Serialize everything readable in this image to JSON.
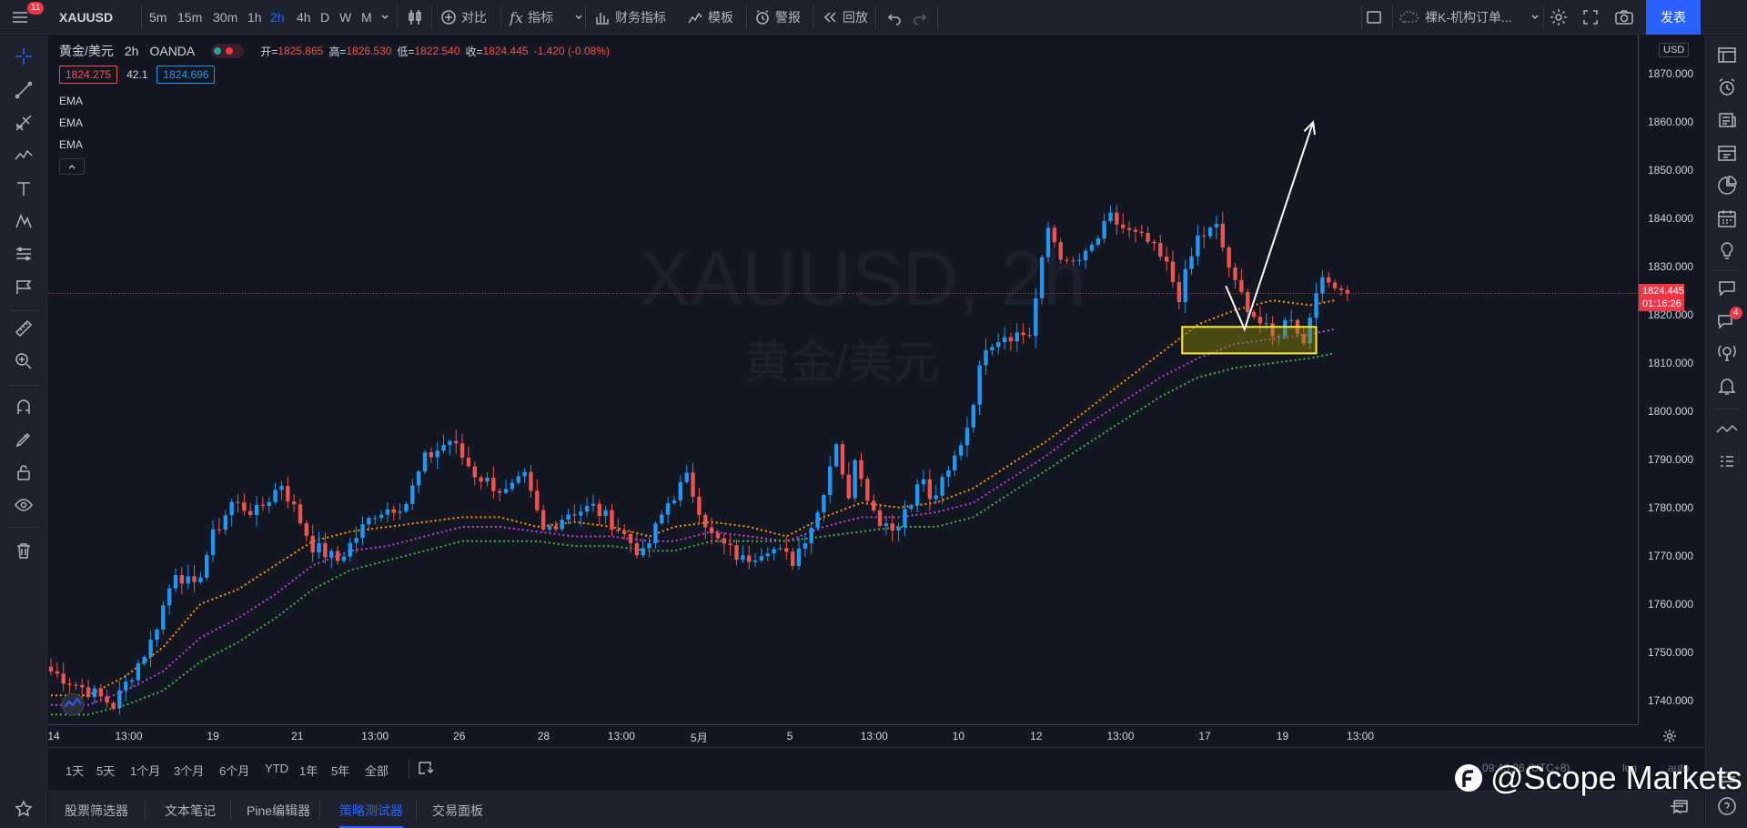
{
  "topbar": {
    "notification_count": "11",
    "symbol": "XAUUSD",
    "timeframes": [
      "5m",
      "15m",
      "30m",
      "1h",
      "2h",
      "4h",
      "D",
      "W",
      "M"
    ],
    "active_timeframe": "2h",
    "compare_label": "对比",
    "indicators_label": "指标",
    "financials_label": "财务指标",
    "templates_label": "模板",
    "alert_label": "警报",
    "replay_label": "回放",
    "layout_name": "裸K-机构订单...",
    "publish_label": "发表"
  },
  "legend": {
    "title": "黄金/美元",
    "interval": "2h",
    "exchange": "OANDA",
    "open_label": "开=",
    "open": "1825.865",
    "high_label": "高=",
    "high": "1826.530",
    "low_label": "低=",
    "low": "1822.540",
    "close_label": "收=",
    "close": "1824.445",
    "change": "-1.420 (-0.08%)",
    "bid": "1824.275",
    "spread": "42.1",
    "ask": "1824.696",
    "indicators": [
      "EMA",
      "EMA",
      "EMA"
    ]
  },
  "watermark": {
    "symbol": "XAUUSD, 2h",
    "name": "黄金/美元"
  },
  "price_axis": {
    "currency": "USD",
    "ticks": [
      "1870.000",
      "1860.000",
      "1850.000",
      "1840.000",
      "1830.000",
      "1820.000",
      "1810.000",
      "1800.000",
      "1790.000",
      "1780.000",
      "1770.000",
      "1760.000",
      "1750.000",
      "1740.000"
    ],
    "last_price": "1824.445",
    "countdown": "01:16:26"
  },
  "time_axis": {
    "ticks": [
      "14",
      "13:00",
      "19",
      "21",
      "13:00",
      "26",
      "28",
      "13:00",
      "5月",
      "5",
      "13:00",
      "10",
      "12",
      "13:00",
      "17",
      "19",
      "13:00"
    ]
  },
  "range_bar": {
    "ranges": [
      "1天",
      "5天",
      "1个月",
      "3个月",
      "6个月",
      "YTD",
      "1年",
      "5年",
      "全部"
    ],
    "clock_text": "09:43:26 (UTC+8)",
    "log_label": "log",
    "auto_label": "auto"
  },
  "bottom_tabs": {
    "tabs": [
      "股票筛选器",
      "文本笔记",
      "Pine编辑器",
      "策略测试器",
      "交易面板"
    ],
    "active": "策略测试器"
  },
  "right_toolbar": {
    "chat_badge": "4"
  },
  "overlay_watermark": "@Scope Markets",
  "colors": {
    "background": "#131722",
    "up_candle": "#2196f3",
    "down_candle": "#ef5350",
    "ema_fast": "#ff9800",
    "ema_mid": "#c040e0",
    "ema_slow": "#4caf50",
    "zone_border": "#ffeb3b",
    "publish_button": "#2962ff"
  },
  "chart_data": {
    "type": "candlestick",
    "symbol": "XAUUSD",
    "interval": "2h",
    "ylim": [
      1735,
      1878
    ],
    "bar_count": 142,
    "anchors": [
      {
        "bar": 0,
        "price": 1746
      },
      {
        "bar": 6,
        "price": 1742
      },
      {
        "bar": 10,
        "price": 1739
      },
      {
        "bar": 16,
        "price": 1752
      },
      {
        "bar": 20,
        "price": 1767
      },
      {
        "bar": 23,
        "price": 1763
      },
      {
        "bar": 26,
        "price": 1774
      },
      {
        "bar": 29,
        "price": 1781
      },
      {
        "bar": 33,
        "price": 1779
      },
      {
        "bar": 37,
        "price": 1785
      },
      {
        "bar": 42,
        "price": 1772
      },
      {
        "bar": 46,
        "price": 1769
      },
      {
        "bar": 52,
        "price": 1779
      },
      {
        "bar": 57,
        "price": 1781
      },
      {
        "bar": 60,
        "price": 1790
      },
      {
        "bar": 64,
        "price": 1794
      },
      {
        "bar": 68,
        "price": 1787
      },
      {
        "bar": 73,
        "price": 1783
      },
      {
        "bar": 76,
        "price": 1786
      },
      {
        "bar": 79,
        "price": 1775
      },
      {
        "bar": 83,
        "price": 1779
      },
      {
        "bar": 87,
        "price": 1780
      },
      {
        "bar": 90,
        "price": 1777
      },
      {
        "bar": 95,
        "price": 1770
      },
      {
        "bar": 99,
        "price": 1781
      },
      {
        "bar": 102,
        "price": 1786
      },
      {
        "bar": 106,
        "price": 1774
      },
      {
        "bar": 111,
        "price": 1769
      },
      {
        "bar": 115,
        "price": 1772
      },
      {
        "bar": 119,
        "price": 1769
      },
      {
        "bar": 123,
        "price": 1779
      },
      {
        "bar": 126,
        "price": 1794
      },
      {
        "bar": 129,
        "price": 1791
      },
      {
        "bar": 132,
        "price": 1779
      },
      {
        "bar": 136,
        "price": 1776
      },
      {
        "bar": 141,
        "price": 1781
      }
    ],
    "anchors_2": [
      {
        "bar": 0,
        "price": 1781
      },
      {
        "bar": 4,
        "price": 1778
      },
      {
        "bar": 8,
        "price": 1778
      },
      {
        "bar": 12,
        "price": 1786
      },
      {
        "bar": 16,
        "price": 1787
      },
      {
        "bar": 19,
        "price": 1797
      },
      {
        "bar": 22,
        "price": 1814
      },
      {
        "bar": 25,
        "price": 1816
      },
      {
        "bar": 29,
        "price": 1816
      },
      {
        "bar": 32,
        "price": 1838
      },
      {
        "bar": 35,
        "price": 1830
      },
      {
        "bar": 38,
        "price": 1832
      },
      {
        "bar": 42,
        "price": 1840
      },
      {
        "bar": 45,
        "price": 1837
      },
      {
        "bar": 48,
        "price": 1835
      },
      {
        "bar": 51,
        "price": 1830
      },
      {
        "bar": 53,
        "price": 1824
      },
      {
        "bar": 56,
        "price": 1836
      },
      {
        "bar": 59,
        "price": 1838
      },
      {
        "bar": 62,
        "price": 1826
      },
      {
        "bar": 65,
        "price": 1820
      },
      {
        "bar": 68,
        "price": 1815
      },
      {
        "bar": 71,
        "price": 1820
      },
      {
        "bar": 73,
        "price": 1814
      },
      {
        "bar": 75,
        "price": 1826
      },
      {
        "bar": 78,
        "price": 1827
      },
      {
        "bar": 80,
        "price": 1824
      }
    ],
    "last_close": 1824.445,
    "ema_fast_points": [
      [
        0,
        1741
      ],
      [
        6,
        1741
      ],
      [
        12,
        1745
      ],
      [
        18,
        1751
      ],
      [
        24,
        1760
      ],
      [
        30,
        1763
      ],
      [
        36,
        1768
      ],
      [
        42,
        1773
      ],
      [
        48,
        1775
      ],
      [
        54,
        1776
      ],
      [
        60,
        1777
      ],
      [
        66,
        1778
      ],
      [
        72,
        1778
      ],
      [
        78,
        1776
      ],
      [
        84,
        1777
      ],
      [
        90,
        1776
      ],
      [
        96,
        1774
      ],
      [
        100,
        1776
      ],
      [
        106,
        1777
      ],
      [
        112,
        1776
      ],
      [
        118,
        1774
      ],
      [
        124,
        1778
      ],
      [
        130,
        1781
      ],
      [
        136,
        1780
      ],
      [
        142,
        1781
      ],
      [
        148,
        1784
      ],
      [
        154,
        1789
      ],
      [
        160,
        1794
      ],
      [
        166,
        1800
      ],
      [
        172,
        1806
      ],
      [
        178,
        1812
      ],
      [
        184,
        1818
      ],
      [
        190,
        1821
      ],
      [
        196,
        1823
      ],
      [
        202,
        1822
      ],
      [
        206,
        1823
      ]
    ],
    "ema_mid_points": [
      [
        0,
        1739
      ],
      [
        6,
        1739
      ],
      [
        12,
        1742
      ],
      [
        18,
        1746
      ],
      [
        24,
        1753
      ],
      [
        30,
        1757
      ],
      [
        36,
        1762
      ],
      [
        42,
        1768
      ],
      [
        48,
        1771
      ],
      [
        54,
        1772
      ],
      [
        60,
        1774
      ],
      [
        66,
        1776
      ],
      [
        72,
        1776
      ],
      [
        78,
        1775
      ],
      [
        84,
        1774
      ],
      [
        90,
        1774
      ],
      [
        96,
        1773
      ],
      [
        100,
        1773
      ],
      [
        106,
        1775
      ],
      [
        112,
        1774
      ],
      [
        118,
        1773
      ],
      [
        124,
        1776
      ],
      [
        130,
        1778
      ],
      [
        136,
        1778
      ],
      [
        142,
        1779
      ],
      [
        148,
        1781
      ],
      [
        154,
        1786
      ],
      [
        160,
        1791
      ],
      [
        166,
        1797
      ],
      [
        172,
        1802
      ],
      [
        178,
        1807
      ],
      [
        184,
        1811
      ],
      [
        190,
        1814
      ],
      [
        196,
        1815
      ],
      [
        202,
        1816
      ],
      [
        206,
        1817
      ]
    ],
    "ema_slow_points": [
      [
        0,
        1737
      ],
      [
        6,
        1737
      ],
      [
        12,
        1739
      ],
      [
        18,
        1742
      ],
      [
        24,
        1748
      ],
      [
        30,
        1752
      ],
      [
        36,
        1757
      ],
      [
        42,
        1763
      ],
      [
        48,
        1767
      ],
      [
        54,
        1769
      ],
      [
        60,
        1771
      ],
      [
        66,
        1773
      ],
      [
        72,
        1773
      ],
      [
        78,
        1773
      ],
      [
        84,
        1772
      ],
      [
        90,
        1772
      ],
      [
        96,
        1771
      ],
      [
        100,
        1771
      ],
      [
        106,
        1773
      ],
      [
        112,
        1773
      ],
      [
        118,
        1773
      ],
      [
        124,
        1774
      ],
      [
        130,
        1775
      ],
      [
        136,
        1776
      ],
      [
        142,
        1776
      ],
      [
        148,
        1778
      ],
      [
        154,
        1783
      ],
      [
        160,
        1788
      ],
      [
        166,
        1793
      ],
      [
        172,
        1798
      ],
      [
        178,
        1803
      ],
      [
        184,
        1807
      ],
      [
        190,
        1809
      ],
      [
        196,
        1810
      ],
      [
        202,
        1811
      ],
      [
        206,
        1812
      ]
    ],
    "zone": {
      "top": 1817.5,
      "bottom": 1812
    },
    "arrow": {
      "from_price": 1826,
      "via_price": 1817,
      "to_price": 1860
    }
  }
}
